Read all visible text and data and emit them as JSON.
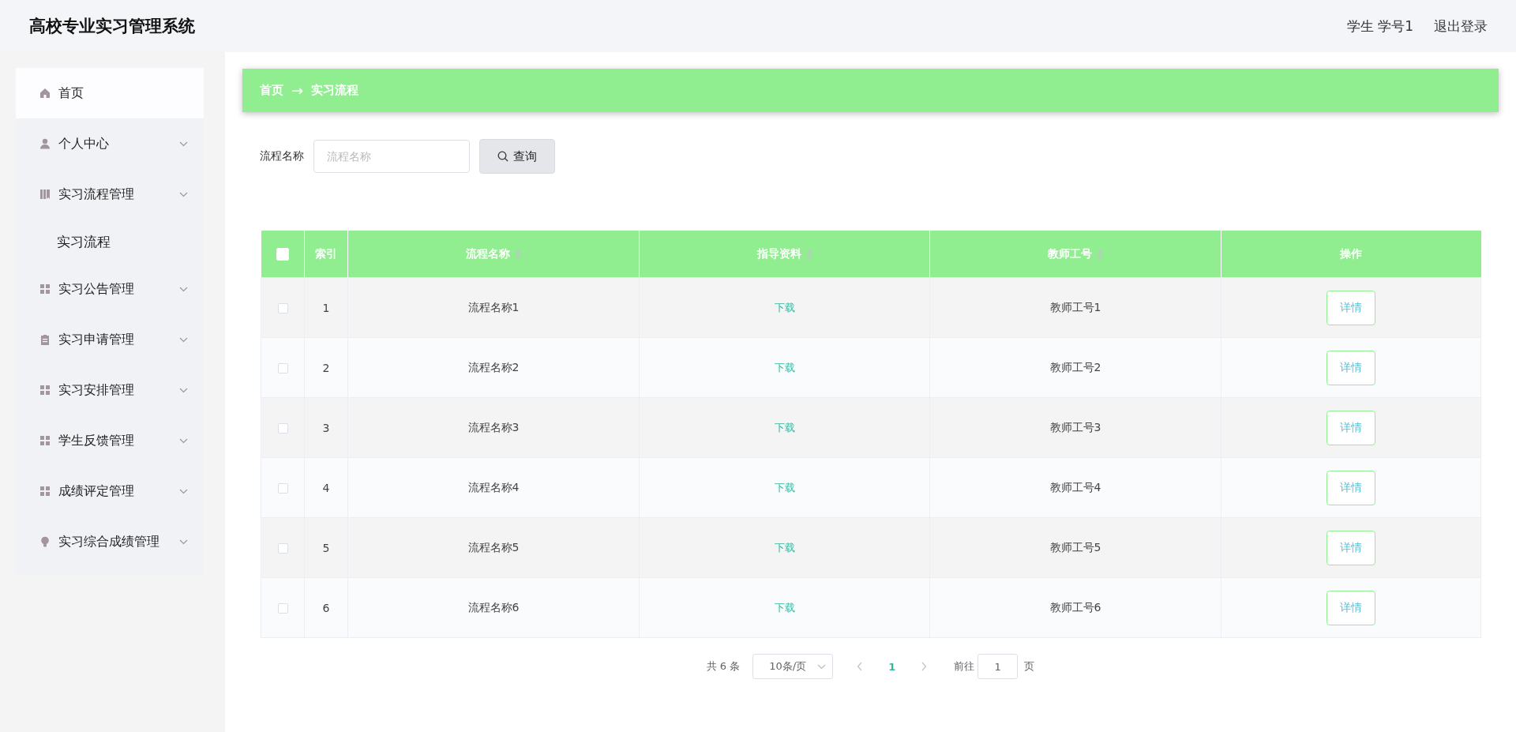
{
  "header": {
    "title": "高校专业实习管理系统",
    "user": "学生 学号1",
    "logout": "退出登录"
  },
  "sidebar": {
    "items": [
      {
        "label": "首页",
        "expandable": false,
        "selected": true
      },
      {
        "label": "个人中心",
        "expandable": true,
        "selected": false
      },
      {
        "label": "实习流程管理",
        "expandable": true,
        "selected": false,
        "children": [
          {
            "label": "实习流程",
            "selected": false
          }
        ]
      },
      {
        "label": "实习公告管理",
        "expandable": true,
        "selected": false
      },
      {
        "label": "实习申请管理",
        "expandable": true,
        "selected": false
      },
      {
        "label": "实习安排管理",
        "expandable": true,
        "selected": false
      },
      {
        "label": "学生反馈管理",
        "expandable": true,
        "selected": false
      },
      {
        "label": "成绩评定管理",
        "expandable": true,
        "selected": false
      },
      {
        "label": "实习综合成绩管理",
        "expandable": true,
        "selected": false
      }
    ]
  },
  "breadcrumb": {
    "items": [
      "首页",
      "实习流程"
    ],
    "separator": "→"
  },
  "search": {
    "label": "流程名称",
    "placeholder": "流程名称",
    "button": "查询"
  },
  "table": {
    "select_all_checked": false,
    "columns": [
      {
        "label": "索引",
        "sortable": false
      },
      {
        "label": "流程名称",
        "sortable": true
      },
      {
        "label": "指导资料",
        "sortable": true
      },
      {
        "label": "教师工号",
        "sortable": true
      },
      {
        "label": "操作",
        "sortable": false
      }
    ],
    "rows": [
      {
        "checked": false,
        "index": "1",
        "name": "流程名称1",
        "material": "下载",
        "teacher": "教师工号1",
        "action": "详情"
      },
      {
        "checked": false,
        "index": "2",
        "name": "流程名称2",
        "material": "下载",
        "teacher": "教师工号2",
        "action": "详情"
      },
      {
        "checked": false,
        "index": "3",
        "name": "流程名称3",
        "material": "下载",
        "teacher": "教师工号3",
        "action": "详情"
      },
      {
        "checked": false,
        "index": "4",
        "name": "流程名称4",
        "material": "下载",
        "teacher": "教师工号4",
        "action": "详情"
      },
      {
        "checked": false,
        "index": "5",
        "name": "流程名称5",
        "material": "下载",
        "teacher": "教师工号5",
        "action": "详情"
      },
      {
        "checked": false,
        "index": "6",
        "name": "流程名称6",
        "material": "下载",
        "teacher": "教师工号6",
        "action": "详情"
      }
    ]
  },
  "pagination": {
    "total": "共 6 条",
    "page_size": "10条/页",
    "pages": [
      {
        "label": "1",
        "selected": true
      }
    ],
    "goto_label": "前往",
    "goto_value": "1",
    "goto_suffix": "页"
  }
}
